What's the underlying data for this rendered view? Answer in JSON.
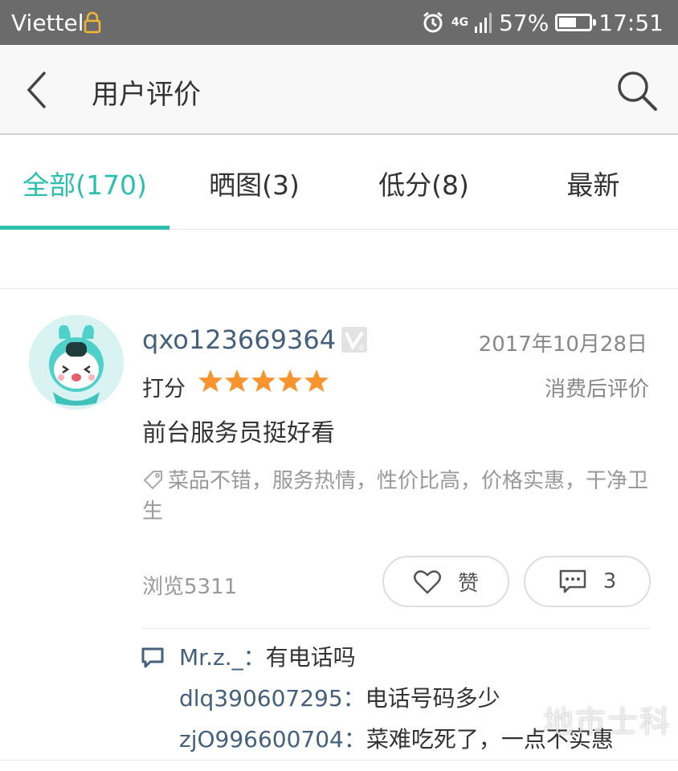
{
  "status_bar": {
    "carrier": "Viettel",
    "network": "4G",
    "battery_percent": "57%",
    "battery_level": 0.57,
    "time": "17:51"
  },
  "header": {
    "title": "用户评价",
    "back_icon": "chevron-left-icon",
    "search_icon": "search-icon"
  },
  "tabs": [
    {
      "label": "全部(170)",
      "active": true
    },
    {
      "label": "晒图(3)",
      "active": false
    },
    {
      "label": "低分(8)",
      "active": false
    },
    {
      "label": "最新",
      "active": false
    }
  ],
  "review": {
    "username": "qxo123669364",
    "date": "2017年10月28日",
    "rating_label": "打分",
    "rating": 5,
    "rating_max": 5,
    "type": "消费后评价",
    "text": "前台服务员挺好看",
    "tags": "菜品不错，服务热情，性价比高，价格实惠，干净卫生",
    "views": "浏览5311",
    "like_label": "赞",
    "comment_count": "3",
    "replies": [
      {
        "user": "Mr.z._：",
        "text": "有电话吗"
      },
      {
        "user": "dlq390607295：",
        "text": "电话号码多少"
      },
      {
        "user": "zjO996600704：",
        "text": "菜难吃死了，一点不实惠"
      }
    ]
  },
  "colors": {
    "accent": "#2bbfae",
    "star": "#f7942e",
    "link": "#44607c"
  },
  "watermark": "地市士科"
}
